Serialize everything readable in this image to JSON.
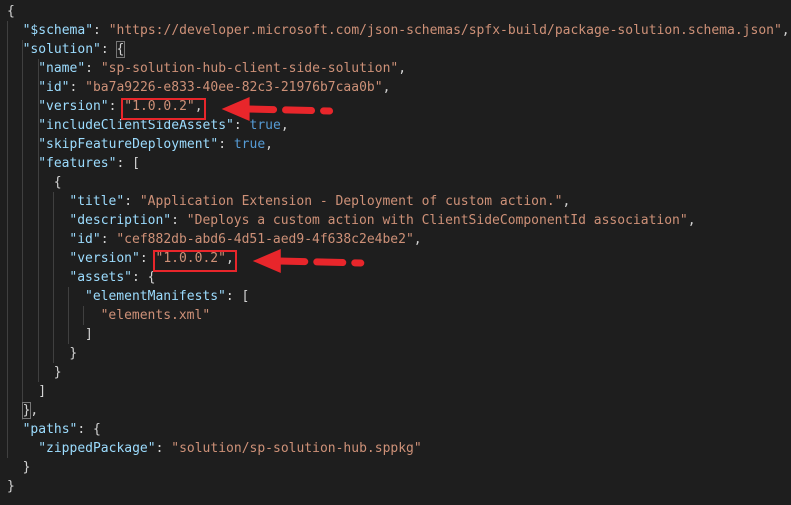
{
  "lines": [
    [
      {
        "t": "{",
        "c": "pun"
      }
    ],
    [
      {
        "t": "\"$schema\"",
        "c": "key"
      },
      {
        "t": ": ",
        "c": "pun"
      },
      {
        "t": "\"https://developer.microsoft.com/json-schemas/spfx-build/package-solution.schema.json\"",
        "c": "str"
      },
      {
        "t": ",",
        "c": "pun"
      }
    ],
    [
      {
        "t": "\"solution\"",
        "c": "key"
      },
      {
        "t": ": ",
        "c": "pun"
      },
      {
        "t": "{",
        "c": "pun",
        "box": true
      }
    ],
    [
      {
        "t": "\"name\"",
        "c": "key"
      },
      {
        "t": ": ",
        "c": "pun"
      },
      {
        "t": "\"sp-solution-hub-client-side-solution\"",
        "c": "str"
      },
      {
        "t": ",",
        "c": "pun"
      }
    ],
    [
      {
        "t": "\"id\"",
        "c": "key"
      },
      {
        "t": ": ",
        "c": "pun"
      },
      {
        "t": "\"ba7a9226-e833-40ee-82c3-21976b7caa0b\"",
        "c": "str"
      },
      {
        "t": ",",
        "c": "pun"
      }
    ],
    [
      {
        "t": "\"version\"",
        "c": "key"
      },
      {
        "t": ": ",
        "c": "pun"
      },
      {
        "t": "\"1.0.0.2\"",
        "c": "str"
      },
      {
        "t": ",",
        "c": "pun"
      }
    ],
    [
      {
        "t": "\"includeClientSideAssets\"",
        "c": "key"
      },
      {
        "t": ": ",
        "c": "pun"
      },
      {
        "t": "true",
        "c": "kw"
      },
      {
        "t": ",",
        "c": "pun"
      }
    ],
    [
      {
        "t": "\"skipFeatureDeployment\"",
        "c": "key"
      },
      {
        "t": ": ",
        "c": "pun"
      },
      {
        "t": "true",
        "c": "kw"
      },
      {
        "t": ",",
        "c": "pun"
      }
    ],
    [
      {
        "t": "\"features\"",
        "c": "key"
      },
      {
        "t": ": [",
        "c": "pun"
      }
    ],
    [
      {
        "t": "{",
        "c": "pun"
      }
    ],
    [
      {
        "t": "\"title\"",
        "c": "key"
      },
      {
        "t": ": ",
        "c": "pun"
      },
      {
        "t": "\"Application Extension - Deployment of custom action.\"",
        "c": "str"
      },
      {
        "t": ",",
        "c": "pun"
      }
    ],
    [
      {
        "t": "\"description\"",
        "c": "key"
      },
      {
        "t": ": ",
        "c": "pun"
      },
      {
        "t": "\"Deploys a custom action with ClientSideComponentId association\"",
        "c": "str"
      },
      {
        "t": ",",
        "c": "pun"
      }
    ],
    [
      {
        "t": "\"id\"",
        "c": "key"
      },
      {
        "t": ": ",
        "c": "pun"
      },
      {
        "t": "\"cef882db-abd6-4d51-aed9-4f638c2e4be2\"",
        "c": "str"
      },
      {
        "t": ",",
        "c": "pun"
      }
    ],
    [
      {
        "t": "\"version\"",
        "c": "key"
      },
      {
        "t": ": ",
        "c": "pun"
      },
      {
        "t": "\"1.0.0.2\"",
        "c": "str"
      },
      {
        "t": ",",
        "c": "pun"
      }
    ],
    [
      {
        "t": "\"assets\"",
        "c": "key"
      },
      {
        "t": ": {",
        "c": "pun"
      }
    ],
    [
      {
        "t": "\"elementManifests\"",
        "c": "key"
      },
      {
        "t": ": [",
        "c": "pun"
      }
    ],
    [
      {
        "t": "\"elements.xml\"",
        "c": "str"
      }
    ],
    [
      {
        "t": "]",
        "c": "pun"
      }
    ],
    [
      {
        "t": "}",
        "c": "pun"
      }
    ],
    [
      {
        "t": "}",
        "c": "pun"
      }
    ],
    [
      {
        "t": "]",
        "c": "pun"
      }
    ],
    [
      {
        "t": "}",
        "c": "pun",
        "box": true
      },
      {
        "t": ",",
        "c": "pun"
      }
    ],
    [
      {
        "t": "\"paths\"",
        "c": "key"
      },
      {
        "t": ": {",
        "c": "pun"
      }
    ],
    [
      {
        "t": "\"zippedPackage\"",
        "c": "key"
      },
      {
        "t": ": ",
        "c": "pun"
      },
      {
        "t": "\"solution/sp-solution-hub.sppkg\"",
        "c": "str"
      }
    ],
    [
      {
        "t": "}",
        "c": "pun"
      }
    ],
    [
      {
        "t": "}",
        "c": "pun"
      }
    ]
  ],
  "colors": {
    "background": "#1e1e1e",
    "key": "#9cdcfe",
    "string": "#ce9178",
    "keyword": "#569cd6",
    "punctuation": "#d4d4d4",
    "annotation": "#e8262b"
  },
  "annotations": [
    {
      "name": "solution-version-highlight",
      "line": 5,
      "target": "\"1.0.0.2\","
    },
    {
      "name": "feature-version-highlight",
      "line": 13,
      "target": "\"1.0.0.2\","
    }
  ]
}
